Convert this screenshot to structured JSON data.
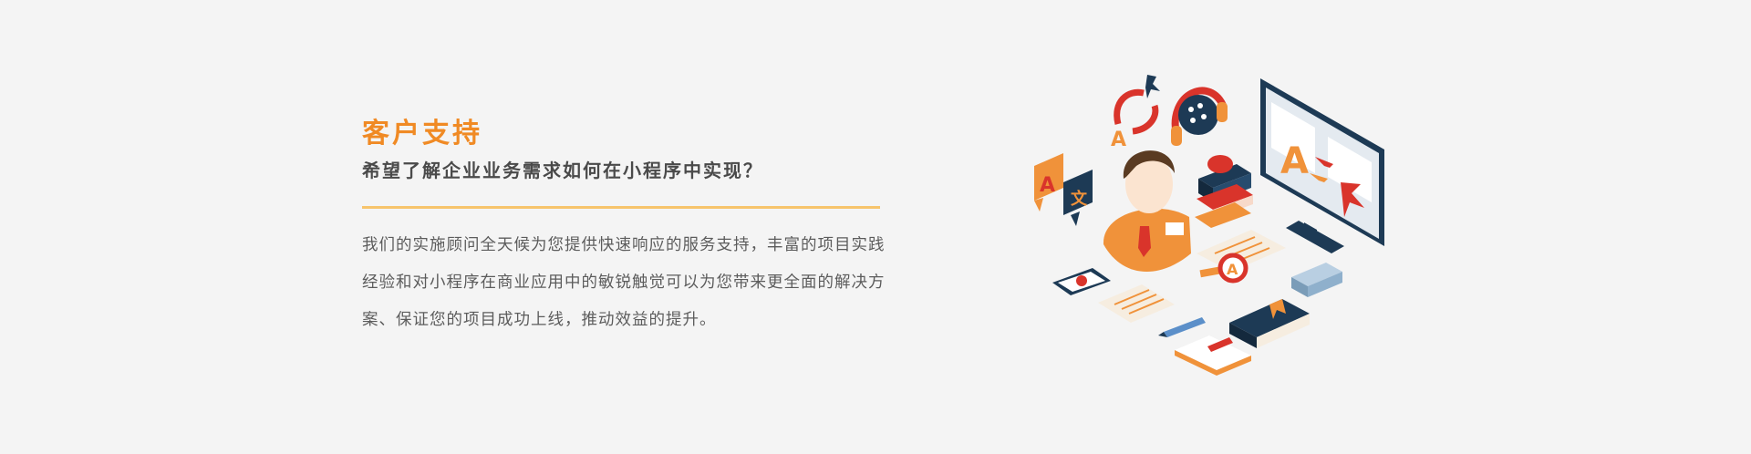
{
  "support": {
    "title": "客户支持",
    "subtitle": "希望了解企业业务需求如何在小程序中实现？",
    "description": "我们的实施顾问全天候为您提供快速响应的服务支持，丰富的项目实践经验和对小程序在商业应用中的敏锐触觉可以为您带来更全面的解决方案、保证您的项目成功上线，推动效益的提升。"
  },
  "illustration": {
    "icon": "customer-support-translation-illustration",
    "colors": {
      "orange": "#f0923a",
      "navy": "#1d3a55",
      "red": "#d9342b",
      "paper": "#f6ede0",
      "screen": "#e4eaf0"
    }
  }
}
